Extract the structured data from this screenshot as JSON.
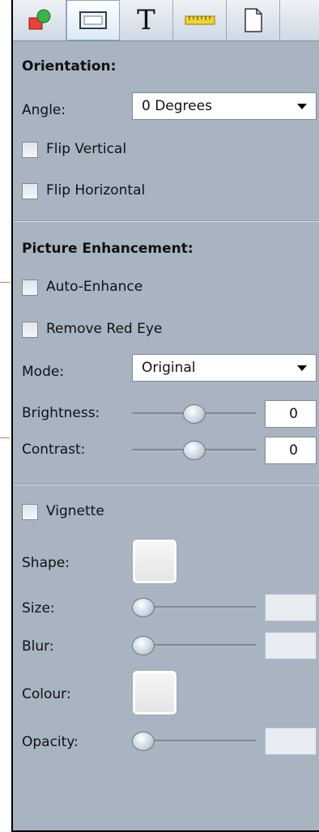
{
  "tabs": [
    {
      "icon": "shapes-icon"
    },
    {
      "icon": "frame-icon"
    },
    {
      "icon": "text-icon",
      "glyph": "T"
    },
    {
      "icon": "ruler-icon"
    },
    {
      "icon": "page-icon"
    }
  ],
  "orientation": {
    "title": "Orientation:",
    "angle_label": "Angle:",
    "angle_value": "0 Degrees",
    "flip_vertical": "Flip Vertical",
    "flip_horizontal": "Flip Horizontal"
  },
  "enhancement": {
    "title": "Picture Enhancement:",
    "auto_enhance": "Auto-Enhance",
    "remove_red_eye": "Remove Red Eye",
    "mode_label": "Mode:",
    "mode_value": "Original",
    "brightness_label": "Brightness:",
    "brightness_value": "0",
    "brightness_level": 0.5,
    "contrast_label": "Contrast:",
    "contrast_value": "0",
    "contrast_level": 0.5
  },
  "vignette": {
    "label": "Vignette",
    "shape_label": "Shape:",
    "size_label": "Size:",
    "blur_label": "Blur:",
    "colour_label": "Colour:",
    "opacity_label": "Opacity:",
    "size_level": 0,
    "blur_level": 0,
    "opacity_level": 0
  },
  "colors": {
    "panel_bg": "#a8b4c2",
    "marker": "#e0752c"
  }
}
